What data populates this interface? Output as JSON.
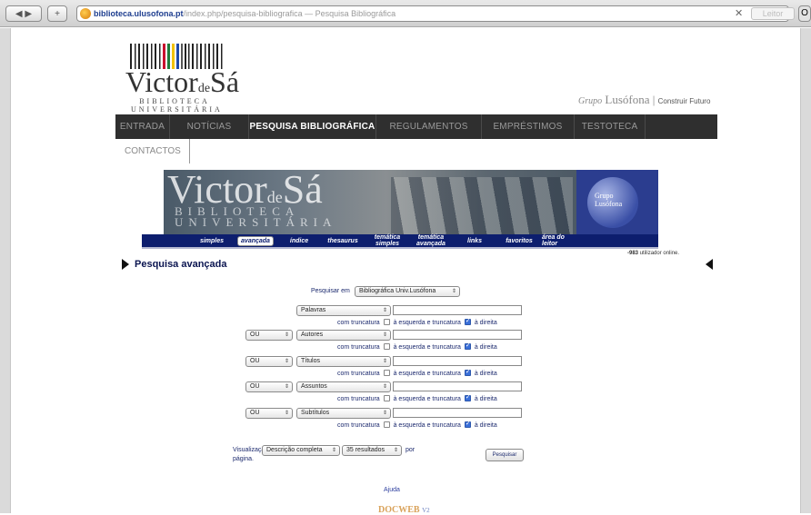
{
  "browser": {
    "url_host": "biblioteca.ulusofona.pt",
    "url_path": "/index.php/pesquisa-bibliografica",
    "page_title": "— Pesquisa Bibliográfica",
    "reader_label": "Leitor"
  },
  "header": {
    "logo_title_a": "Victor",
    "logo_title_de": "de",
    "logo_title_b": "Sá",
    "logo_sub_1": "BIBLIOTECA",
    "logo_sub_2": "UNIVERSITÁRIA",
    "grupo_label": "Grupo",
    "grupo_name": "Lusófona",
    "grupo_slogan": "Construir Futuro"
  },
  "nav": {
    "items": [
      {
        "label": "ENTRADA"
      },
      {
        "label": "NOTÍCIAS"
      },
      {
        "label": "PESQUISA BIBLIOGRÁFICA"
      },
      {
        "label": "REGULAMENTOS"
      },
      {
        "label": "EMPRÉSTIMOS"
      },
      {
        "label": "TESTOTECA"
      },
      {
        "label": ""
      }
    ],
    "row2": "CONTACTOS"
  },
  "banner": {
    "title_a": "Victor",
    "title_de": "de",
    "title_b": "Sá",
    "sub_1": "BIBLIOTECA",
    "sub_2": "UNIVERSITÁRIA",
    "luso_1": "Grupo",
    "luso_2": "Lusófona"
  },
  "subnav": {
    "items": [
      {
        "l1": "simples",
        "l2": ""
      },
      {
        "l1": "avançada",
        "l2": ""
      },
      {
        "l1": "índice",
        "l2": ""
      },
      {
        "l1": "thesaurus",
        "l2": ""
      },
      {
        "l1": "temática",
        "l2": "simples"
      },
      {
        "l1": "temática",
        "l2": "avançada"
      },
      {
        "l1": "links",
        "l2": ""
      },
      {
        "l1": "favoritos",
        "l2": ""
      },
      {
        "l1": "área do",
        "l2": "leitor"
      }
    ],
    "online_count": "-983",
    "online_label": "utilizador online."
  },
  "search": {
    "section_title": "Pesquisa avançada",
    "pesquisar_em_label": "Pesquisar em",
    "pesquisar_em_value": "Bibliográfica Univ.Lusófona",
    "truncatura_prefix": "com truncatura",
    "truncatura_middle": "à esquerda e truncatura",
    "truncatura_suffix": "à direita",
    "operator": "OU",
    "fields": [
      {
        "name": "Palavras"
      },
      {
        "name": "Autores"
      },
      {
        "name": "Títulos"
      },
      {
        "name": "Assuntos"
      },
      {
        "name": "Subtítulos"
      }
    ],
    "visualizacao_label": "Visualização",
    "visualizacao_value": "Descrição completa",
    "resultados_value": "35 resultados",
    "por_label": "por",
    "pagina_label": "página.",
    "submit_label": "Pesquisar"
  },
  "footer": {
    "ajuda": "Ajuda",
    "docweb": "DOCWEB",
    "version": "V2"
  }
}
